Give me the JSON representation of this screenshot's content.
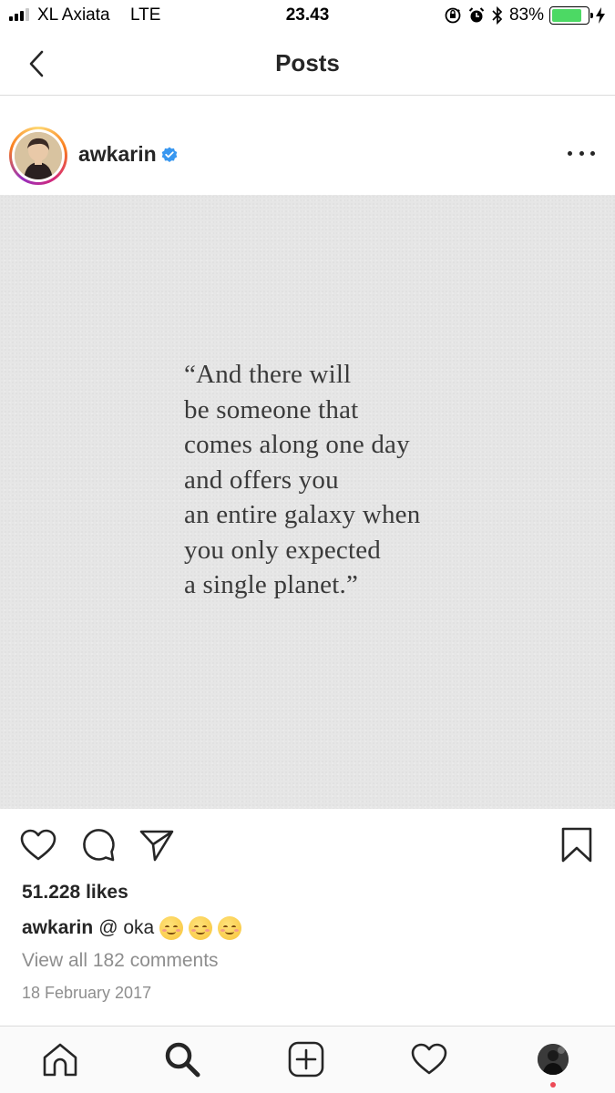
{
  "status_bar": {
    "carrier": "XL Axiata",
    "network": "LTE",
    "time": "23.43",
    "battery_percent_label": "83%",
    "battery_level": 0.83,
    "battery_color": "#4cd964"
  },
  "header": {
    "title": "Posts",
    "back_icon": "chevron-left-icon"
  },
  "post": {
    "username": "awkarin",
    "verified": true,
    "verified_color": "#3897f0",
    "image_text": "“And there will\nbe someone that\ncomes along one day\nand offers you\nan entire galaxy when\nyou only expected\na single planet.”",
    "likes": "51.228 likes",
    "caption_user": "awkarin",
    "caption_text": "@ oka",
    "caption_emojis": [
      "relieved-smile-emoji",
      "relieved-smile-emoji",
      "relieved-smile-emoji"
    ],
    "view_comments": "View all 182 comments",
    "date": "18 February 2017"
  },
  "actions": [
    "heart-icon",
    "comment-icon",
    "share-icon",
    "bookmark-icon"
  ],
  "tab_bar": [
    "home-icon",
    "search-icon",
    "add-post-icon",
    "activity-heart-icon",
    "profile-avatar"
  ],
  "colors": {
    "text": "#262626",
    "muted": "#8e8e8e",
    "divider": "#dbdbdb",
    "notification_dot": "#ed4956"
  }
}
